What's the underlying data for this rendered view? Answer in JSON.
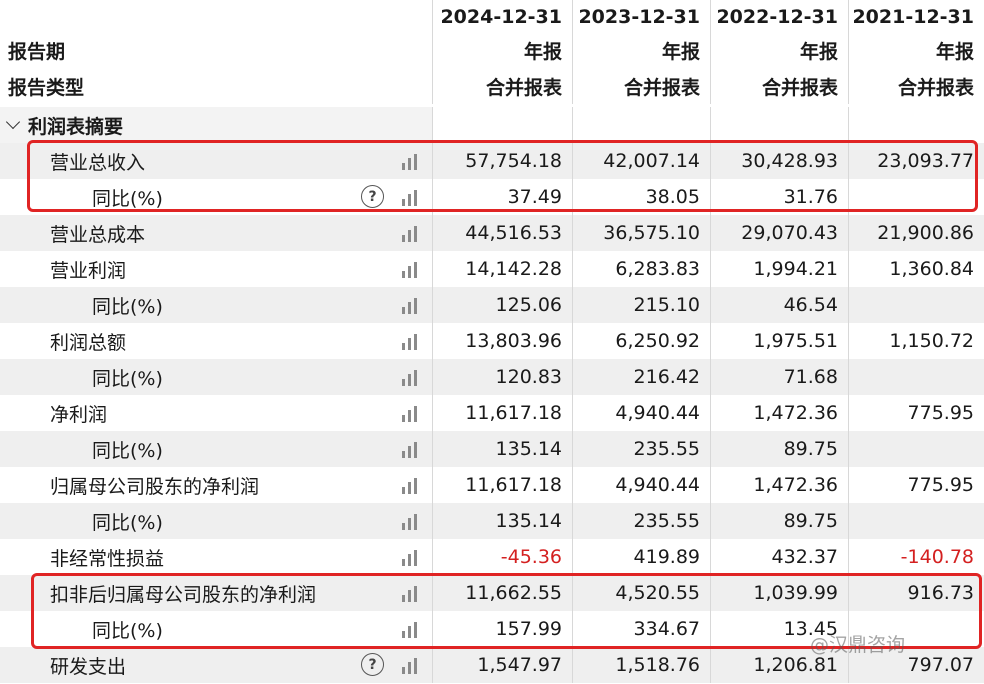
{
  "header": {
    "report_period_label": "报告期",
    "report_type_label": "报告类型",
    "periods": [
      "2024-12-31",
      "2023-12-31",
      "2022-12-31",
      "2021-12-31"
    ],
    "report_kind": [
      "年报",
      "年报",
      "年报",
      "年报"
    ],
    "statement_type": [
      "合并报表",
      "合并报表",
      "合并报表",
      "合并报表"
    ]
  },
  "section": {
    "title": "利润表摘要"
  },
  "rows": [
    {
      "label": "营业总收入",
      "values": [
        "57,754.18",
        "42,007.14",
        "30,428.93",
        "23,093.77"
      ]
    },
    {
      "label": "同比(%)",
      "values": [
        "37.49",
        "38.05",
        "31.76",
        ""
      ]
    },
    {
      "label": "营业总成本",
      "values": [
        "44,516.53",
        "36,575.10",
        "29,070.43",
        "21,900.86"
      ]
    },
    {
      "label": "营业利润",
      "values": [
        "14,142.28",
        "6,283.83",
        "1,994.21",
        "1,360.84"
      ]
    },
    {
      "label": "同比(%)",
      "values": [
        "125.06",
        "215.10",
        "46.54",
        ""
      ]
    },
    {
      "label": "利润总额",
      "values": [
        "13,803.96",
        "6,250.92",
        "1,975.51",
        "1,150.72"
      ]
    },
    {
      "label": "同比(%)",
      "values": [
        "120.83",
        "216.42",
        "71.68",
        ""
      ]
    },
    {
      "label": "净利润",
      "values": [
        "11,617.18",
        "4,940.44",
        "1,472.36",
        "775.95"
      ]
    },
    {
      "label": "同比(%)",
      "values": [
        "135.14",
        "235.55",
        "89.75",
        ""
      ]
    },
    {
      "label": "归属母公司股东的净利润",
      "values": [
        "11,617.18",
        "4,940.44",
        "1,472.36",
        "775.95"
      ]
    },
    {
      "label": "同比(%)",
      "values": [
        "135.14",
        "235.55",
        "89.75",
        ""
      ]
    },
    {
      "label": "非经常性损益",
      "values": [
        "-45.36",
        "419.89",
        "432.37",
        "-140.78"
      ]
    },
    {
      "label": "扣非后归属母公司股东的净利润",
      "values": [
        "11,662.55",
        "4,520.55",
        "1,039.99",
        "916.73"
      ]
    },
    {
      "label": "同比(%)",
      "values": [
        "157.99",
        "334.67",
        "13.45",
        ""
      ]
    },
    {
      "label": "研发支出",
      "values": [
        "1,547.97",
        "1,518.76",
        "1,206.81",
        "797.07"
      ]
    }
  ],
  "help_icon_text": "?",
  "colors": {
    "highlight": "#e02424",
    "negative": "#d42020",
    "stripe": "#efefef"
  },
  "icons": {
    "chart": "bar-chart-icon",
    "help": "help-circle-icon",
    "collapse": "chevron-down-icon"
  },
  "watermark": "@汉鼎咨询"
}
